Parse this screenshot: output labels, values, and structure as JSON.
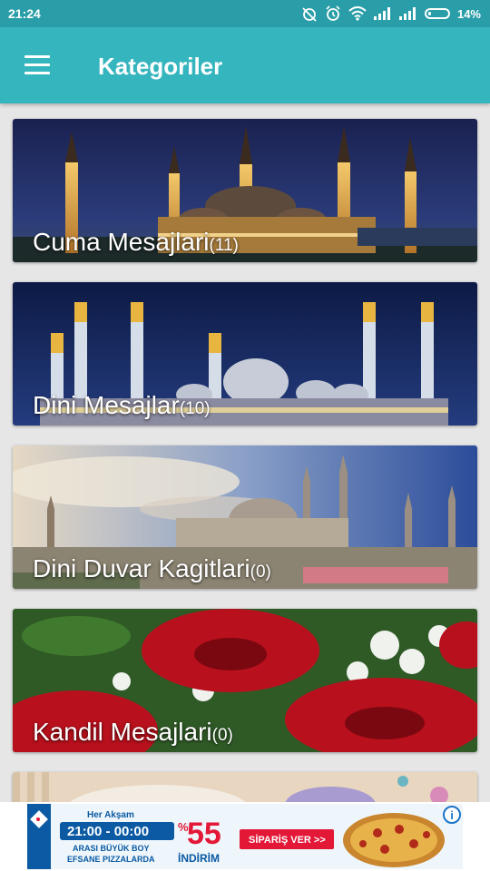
{
  "status_bar": {
    "time": "21:24",
    "battery_percent": "14%",
    "icons": [
      "alarm-off-icon",
      "alarm-icon",
      "wifi-icon",
      "signal-icon",
      "signal-icon",
      "battery-icon"
    ]
  },
  "app_bar": {
    "title": "Kategoriler",
    "menu_icon": "hamburger-menu-icon",
    "background": "#35b5be"
  },
  "categories": [
    {
      "name": "Cuma Mesajlari",
      "count": "(11)",
      "image": "blue-mosque-night"
    },
    {
      "name": "Dini Mesajlar",
      "count": "(10)",
      "image": "mosque-illuminated-night"
    },
    {
      "name": "Dini Duvar Kagitlari",
      "count": "(0)",
      "image": "suleymaniye-mosque-day"
    },
    {
      "name": "Kandil Mesajlari",
      "count": "(0)",
      "image": "red-roses"
    }
  ],
  "ad": {
    "text_top": "Her Akşam",
    "time_range": "21:00 - 00:00",
    "line_2": "ARASI BÜYÜK BOY",
    "line_3": "EFSANE PIZZALARDA",
    "percent": "55",
    "percent_sign": "%",
    "discount_label": "İNDİRİM",
    "cta": "SİPARİŞ VER >>",
    "info_icon": "i"
  }
}
